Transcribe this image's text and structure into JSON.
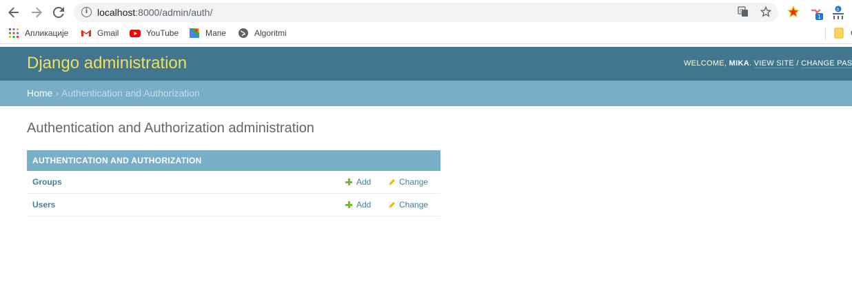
{
  "browser": {
    "url_host": "localhost",
    "url_path": ":8000/admin/auth/",
    "bookmarks": [
      {
        "label": "Апликације",
        "icon": "apps-grid-icon"
      },
      {
        "label": "Gmail",
        "icon": "gmail-icon"
      },
      {
        "label": "YouTube",
        "icon": "youtube-icon"
      },
      {
        "label": "Мапе",
        "icon": "maps-icon"
      },
      {
        "label": "Algoritmi",
        "icon": "globe-icon"
      }
    ],
    "folder_label": "C"
  },
  "header": {
    "branding": "Django administration",
    "welcome": "WELCOME, ",
    "username": "MIKA",
    "view_site": "VIEW SITE",
    "separator": " / ",
    "change_password": "CHANGE PASSW"
  },
  "breadcrumbs": {
    "home": "Home",
    "separator": "›",
    "current": "Authentication and Authorization"
  },
  "content": {
    "title": "Authentication and Authorization administration",
    "module": {
      "caption": "AUTHENTICATION AND AUTHORIZATION",
      "rows": [
        {
          "model": "Groups",
          "add": "Add",
          "change": "Change"
        },
        {
          "model": "Users",
          "add": "Add",
          "change": "Change"
        }
      ]
    }
  },
  "colors": {
    "header_bg": "#417690",
    "branding": "#f5dd5d",
    "breadcrumbs_bg": "#79aec8",
    "link": "#447e9b",
    "add_icon": "#70bf2b",
    "change_icon": "#efb80b"
  }
}
